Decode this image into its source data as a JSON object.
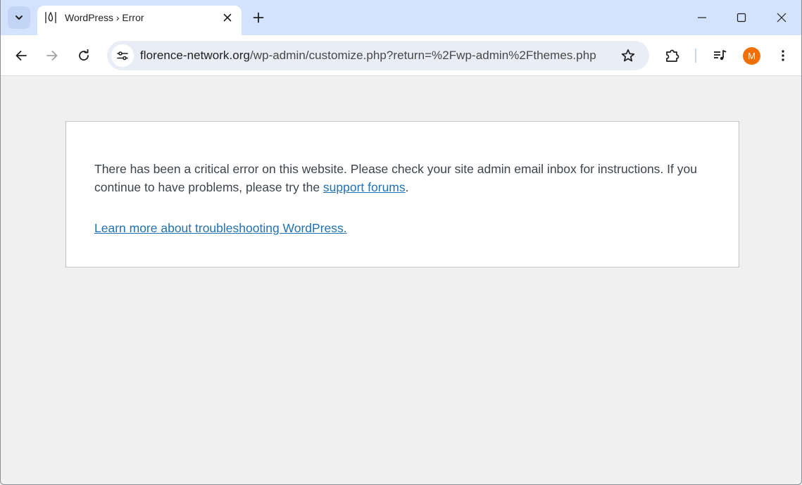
{
  "browser": {
    "tab": {
      "title": "WordPress › Error"
    },
    "address_bar": {
      "url_host": "florence-network.org",
      "url_path": "/wp-admin/customize.php?return=%2Fwp-admin%2Fthemes.php"
    },
    "profile_initial": "M",
    "icons": {
      "tab_search": "chevron-down-icon",
      "favicon": "wordpress-error-icon",
      "tab_close": "close-icon",
      "new_tab": "plus-icon",
      "minimize": "minimize-icon",
      "maximize": "maximize-icon",
      "close_window": "close-icon",
      "back": "arrow-left-icon",
      "forward": "arrow-right-icon",
      "reload": "reload-icon",
      "site_info": "tune-icon",
      "bookmark": "star-icon",
      "extensions": "puzzle-icon",
      "media": "media-queue-icon",
      "menu": "more-vert-icon"
    },
    "colors": {
      "tabstrip": "#d3e3fd",
      "avatar": "#f07007",
      "link": "#2271b1"
    }
  },
  "page": {
    "message_part1": "There has been a critical error on this website. Please check your site admin email inbox for instructions. If you continue to have problems, please try the ",
    "support_link": "support forums",
    "message_part2": ".",
    "learn_more_link": "Learn more about troubleshooting WordPress."
  }
}
